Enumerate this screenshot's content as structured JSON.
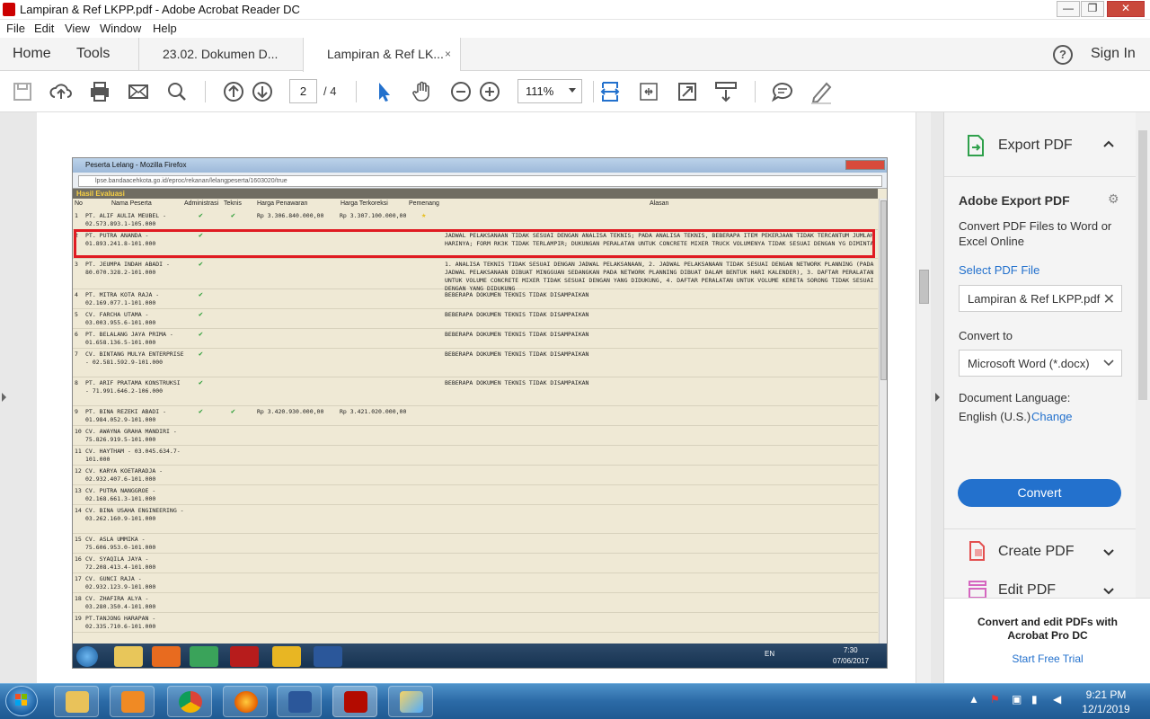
{
  "window": {
    "title": "Lampiran & Ref LKPP.pdf - Adobe Acrobat Reader DC",
    "minimize": "—",
    "maximize": "❐",
    "close": "✕"
  },
  "menu": [
    "File",
    "Edit",
    "View",
    "Window",
    "Help"
  ],
  "tabs": {
    "home": "Home",
    "tools": "Tools",
    "doc1": "23.02. Dokumen D...",
    "doc2": "Lampiran & Ref LK...",
    "close": "×",
    "help": "?",
    "sign_in": "Sign In"
  },
  "toolbar": {
    "page_current": "2",
    "page_total": "/ 4",
    "zoom": "111%",
    "icons": [
      "save-icon",
      "upload-icon",
      "print-icon",
      "email-icon",
      "search-icon",
      "page-up-icon",
      "page-down-icon",
      "select-cursor-icon",
      "hand-icon",
      "zoom-out-icon",
      "zoom-in-icon",
      "fit-width-icon",
      "fit-page-icon",
      "full-screen-icon",
      "scroll-mode-icon",
      "comment-icon",
      "highlight-pen-icon"
    ]
  },
  "right_panel": {
    "export_title": "Export PDF",
    "section_title": "Adobe Export PDF",
    "description": "Convert PDF Files to Word or Excel Online",
    "select_label": "Select PDF File",
    "selected_file": "Lampiran & Ref LKPP.pdf",
    "convert_to_label": "Convert to",
    "convert_to_value": "Microsoft Word (*.docx)",
    "doc_lang_label": "Document Language:",
    "doc_lang_value": "English (U.S.)",
    "change_link": "Change",
    "convert_button": "Convert",
    "create_pdf": "Create PDF",
    "edit_pdf": "Edit PDF",
    "promo": "Convert and edit PDFs with Acrobat Pro DC",
    "trial_link": "Start Free Trial"
  },
  "embedded": {
    "browser_title": "Peserta Lelang - Mozilla Firefox",
    "url": "lpse.bandaacehkota.go.id/eproc/rekanan/lelangpeserta/1603020/true",
    "section": "Hasil Evaluasi",
    "columns": {
      "no": "No",
      "nama": "Nama Peserta",
      "adm": "Administrasi",
      "tek": "Teknis",
      "hp": "Harga Penawaran",
      "hk": "Harga Terkoreksi",
      "pm": "Pemenang",
      "al": "Alasan"
    },
    "rows": [
      {
        "no": "1",
        "nama": "PT. ALIF AULIA MEUBEL - 02.573.893.1-105.000",
        "adm": "✔",
        "tek": "✔",
        "hp": "Rp 3.306.840.000,00",
        "hk": "Rp 3.307.100.000,00",
        "pm": "★",
        "al": ""
      },
      {
        "no": "2",
        "nama": "PT. PUTRA ANANDA - 01.893.241.8-101.000",
        "adm": "✔",
        "tek": "",
        "hp": "",
        "hk": "",
        "pm": "",
        "al": "JADWAL PELAKSANAAN TIDAK SESUAI DENGAN ANALISA TEKNIS; PADA ANALISA TEKNIS, BEBERAPA ITEM PEKERJAAN TIDAK TERCANTUM JUMLAH HARINYA; FORM RK3K TIDAK TERLAMPIR; DUKUNGAN PERALATAN UNTUK CONCRETE MIXER TRUCK VOLUMENYA TIDAK SESUAI DENGAN YG DIMINTA"
      },
      {
        "no": "3",
        "nama": "PT. JEUMPA INDAH ABADI - 80.070.328.2-101.000",
        "adm": "✔",
        "tek": "",
        "hp": "",
        "hk": "",
        "pm": "",
        "al": "1. ANALISA TEKNIS TIDAK SESUAI DENGAN JADWAL PELAKSANAAN, 2. JADWAL PELAKSANAAN TIDAK SESUAI DENGAN NETWORK PLANNING (PADA JADWAL PELAKSANAAN DIBUAT MINGGUAN SEDANGKAN PADA NETWORK PLANNING DIBUAT DALAM BENTUK HARI KALENDER), 3. DAFTAR PERALATAN UNTUK VOLUME CONCRETE MIXER TIDAK SESUAI DENGAN YANG DIDUKUNG, 4. DAFTAR PERALATAN UNTUK VOLUME KERETA SORONG TIDAK SESUAI DENGAN YANG DIDUKUNG"
      },
      {
        "no": "4",
        "nama": "PT. MITRA KOTA RAJA - 02.169.077.1-101.000",
        "adm": "✔",
        "tek": "",
        "hp": "",
        "hk": "",
        "pm": "",
        "al": "BEBERAPA DOKUMEN TEKNIS TIDAK DISAMPAIKAN"
      },
      {
        "no": "5",
        "nama": "CV. FARCHA UTAMA - 03.003.955.6-101.000",
        "adm": "✔",
        "tek": "",
        "hp": "",
        "hk": "",
        "pm": "",
        "al": "BEBERAPA DOKUMEN TEKNIS TIDAK DISAMPAIKAN"
      },
      {
        "no": "6",
        "nama": "PT. BELALANG JAYA PRIMA - 01.658.136.5-101.000",
        "adm": "✔",
        "tek": "",
        "hp": "",
        "hk": "",
        "pm": "",
        "al": "BEBERAPA DOKUMEN TEKNIS TIDAK DISAMPAIKAN"
      },
      {
        "no": "7",
        "nama": "CV. BINTANG MULYA ENTERPRISE - 02.581.592.9-101.000",
        "adm": "✔",
        "tek": "",
        "hp": "",
        "hk": "",
        "pm": "",
        "al": "BEBERAPA DOKUMEN TEKNIS TIDAK DISAMPAIKAN"
      },
      {
        "no": "8",
        "nama": "PT. ARIF PRATAMA KONSTRUKSI - 71.991.646.2-106.000",
        "adm": "✔",
        "tek": "",
        "hp": "",
        "hk": "",
        "pm": "",
        "al": "BEBERAPA DOKUMEN TEKNIS TIDAK DISAMPAIKAN"
      },
      {
        "no": "9",
        "nama": "PT. BINA REZEKI ABADI - 01.984.052.9-101.000",
        "adm": "✔",
        "tek": "✔",
        "hp": "Rp 3.420.930.000,00",
        "hk": "Rp 3.421.020.000,00",
        "pm": "",
        "al": ""
      },
      {
        "no": "10",
        "nama": "CV. AWAYNA GRAHA MANDIRI - 75.826.919.5-101.000",
        "adm": "",
        "tek": "",
        "hp": "",
        "hk": "",
        "pm": "",
        "al": ""
      },
      {
        "no": "11",
        "nama": "CV. HAYTHAM - 03.045.634.7-101.000",
        "adm": "",
        "tek": "",
        "hp": "",
        "hk": "",
        "pm": "",
        "al": ""
      },
      {
        "no": "12",
        "nama": "CV. KARYA KOETARADJA - 02.932.407.6-101.000",
        "adm": "",
        "tek": "",
        "hp": "",
        "hk": "",
        "pm": "",
        "al": ""
      },
      {
        "no": "13",
        "nama": "CV. PUTRA NANGGROE - 02.168.661.3-101.000",
        "adm": "",
        "tek": "",
        "hp": "",
        "hk": "",
        "pm": "",
        "al": ""
      },
      {
        "no": "14",
        "nama": "CV. BINA USAHA ENGINEERING - 03.262.160.9-101.000",
        "adm": "",
        "tek": "",
        "hp": "",
        "hk": "",
        "pm": "",
        "al": ""
      },
      {
        "no": "15",
        "nama": "CV. ASLA UMMIKA - 75.606.953.0-101.000",
        "adm": "",
        "tek": "",
        "hp": "",
        "hk": "",
        "pm": "",
        "al": ""
      },
      {
        "no": "16",
        "nama": "CV. SYAQILA JAYA - 72.208.413.4-101.000",
        "adm": "",
        "tek": "",
        "hp": "",
        "hk": "",
        "pm": "",
        "al": ""
      },
      {
        "no": "17",
        "nama": "CV. GUNCI RAJA - 02.932.123.9-101.000",
        "adm": "",
        "tek": "",
        "hp": "",
        "hk": "",
        "pm": "",
        "al": ""
      },
      {
        "no": "18",
        "nama": "CV. ZHAFIRA ALYA - 03.280.350.4-101.000",
        "adm": "",
        "tek": "",
        "hp": "",
        "hk": "",
        "pm": "",
        "al": ""
      },
      {
        "no": "19",
        "nama": "PT.TANJONG HARAPAN - 02.335.710.6-101.000",
        "adm": "",
        "tek": "",
        "hp": "",
        "hk": "",
        "pm": "",
        "al": ""
      }
    ],
    "tray_lang": "EN",
    "tray_time": "7:30",
    "tray_date": "07/06/2017"
  },
  "taskbar": {
    "time": "9:21 PM",
    "date": "12/1/2019",
    "apps": [
      "explorer-icon",
      "media-player-icon",
      "chrome-icon",
      "firefox-icon",
      "word-icon",
      "acrobat-icon",
      "paint-icon"
    ]
  },
  "colors": {
    "accent": "#2371cd",
    "highlight_box": "#e01b22",
    "check": "#2a9c35"
  }
}
